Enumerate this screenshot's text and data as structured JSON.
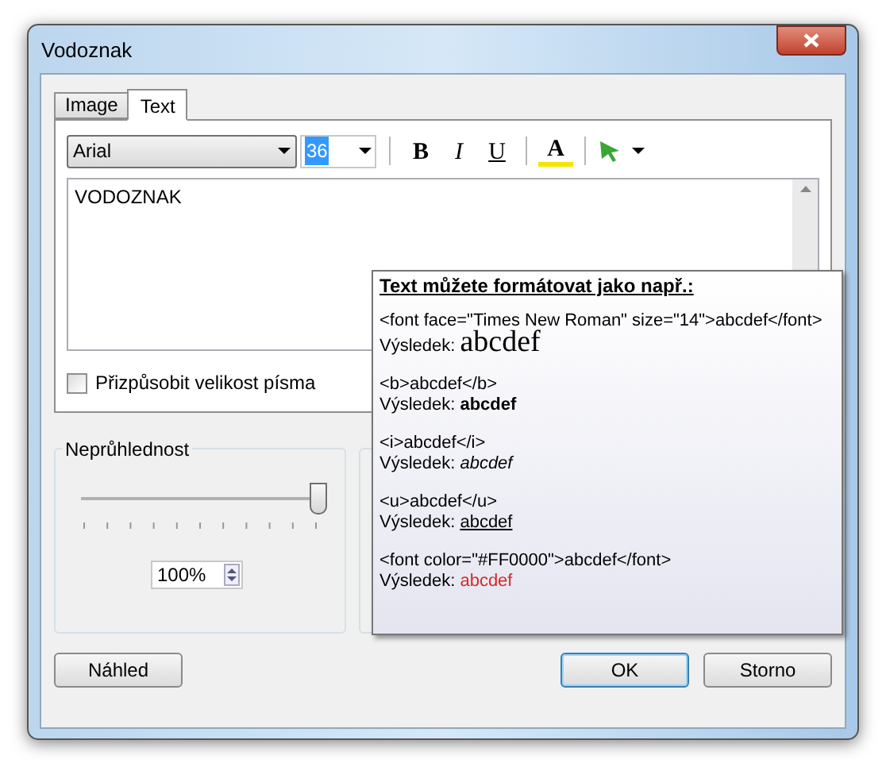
{
  "window": {
    "title": "Vodoznak"
  },
  "tabs": [
    {
      "label": "Image",
      "selected": false
    },
    {
      "label": "Text",
      "selected": true
    }
  ],
  "toolbar": {
    "font": "Arial",
    "size": "36",
    "bold": "B",
    "italic": "I",
    "underline": "U",
    "text_color_button": "A"
  },
  "editor": {
    "value": "VODOZNAK"
  },
  "fit_font_size": {
    "label": "Přizpůsobit velikost písma",
    "checked": false
  },
  "opacity": {
    "title": "Neprůhlednost",
    "level": 1,
    "value": "100%"
  },
  "tooltip": {
    "heading": "Text můžete formátovat jako např.:",
    "examples": [
      {
        "code": "<font face=\"Times New Roman\" size=\"14\">abcdef</font>",
        "result_label": "Výsledek:",
        "sample": "abcdef",
        "kind": "serif"
      },
      {
        "code": "<b>abcdef</b>",
        "result_label": "Výsledek:",
        "sample": "abcdef",
        "kind": "bold"
      },
      {
        "code": "<i>abcdef</i>",
        "result_label": "Výsledek:",
        "sample": "abcdef",
        "kind": "italic"
      },
      {
        "code": "<u>abcdef</u>",
        "result_label": "Výsledek:",
        "sample": "abcdef",
        "kind": "underline"
      },
      {
        "code": "<font color=\"#FF0000\">abcdef</font>",
        "result_label": "Výsledek:",
        "sample": "abcdef",
        "kind": "color",
        "color": "#d42a2a"
      }
    ]
  },
  "buttons": [
    {
      "label": "Náhled",
      "default": false
    },
    {
      "label": "OK",
      "default": true
    },
    {
      "label": "Storno",
      "default": false
    }
  ]
}
